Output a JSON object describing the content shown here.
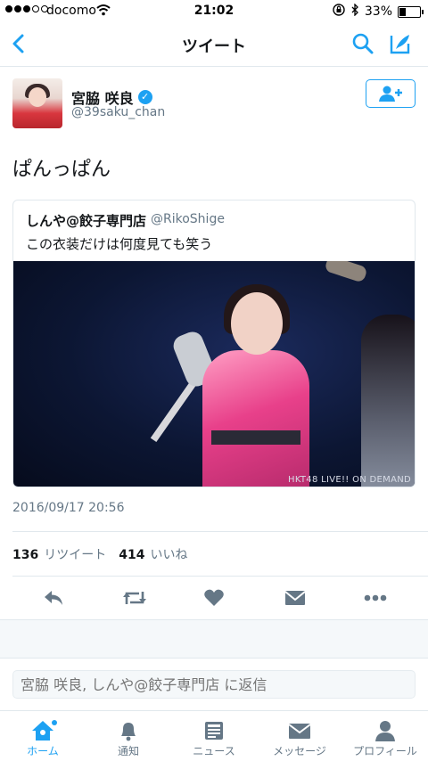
{
  "status_bar": {
    "carrier": "docomo",
    "time": "21:02",
    "battery": "33%"
  },
  "nav": {
    "title": "ツイート"
  },
  "user": {
    "name": "宮脇 咲良",
    "handle": "@39saku_chan"
  },
  "tweet": {
    "text": "ぱんっぱん",
    "timestamp": "2016/09/17 20:56"
  },
  "quote": {
    "name": "しんや@餃子専門店",
    "handle": "@RikoShige",
    "text": "この衣装だけは何度見ても笑う",
    "image_watermark": "HKT48 LIVE!! ON DEMAND"
  },
  "stats": {
    "retweets_count": "136",
    "retweets_label": "リツイート",
    "likes_count": "414",
    "likes_label": "いいね"
  },
  "reply": {
    "placeholder": "宮脇 咲良, しんや@餃子専門店 に返信"
  },
  "tabs": [
    {
      "label": "ホーム"
    },
    {
      "label": "通知"
    },
    {
      "label": "ニュース"
    },
    {
      "label": "メッセージ"
    },
    {
      "label": "プロフィール"
    }
  ],
  "colors": {
    "accent": "#1da1f2",
    "secondary_text": "#657786"
  }
}
